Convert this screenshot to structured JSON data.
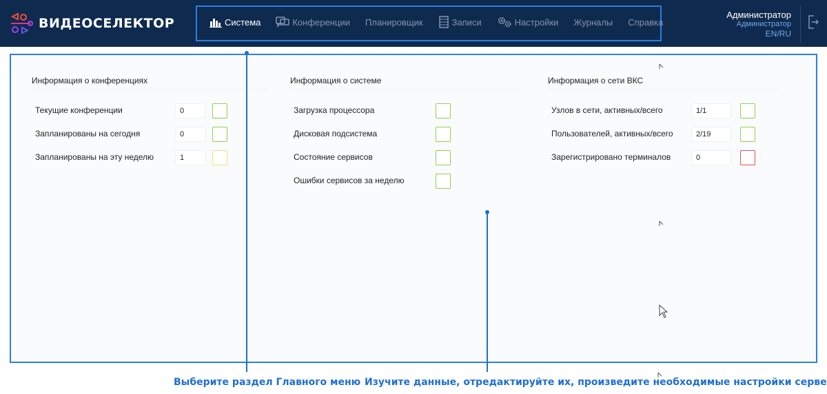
{
  "app": {
    "logo_text": "ВИДЕОСЕЛЕКТОР"
  },
  "nav": {
    "items": [
      {
        "label": "Система",
        "icon": "bar-chart-icon",
        "active": true
      },
      {
        "label": "Конференции",
        "icon": "chat-bubbles-icon",
        "active": false
      },
      {
        "label": "Планировщик",
        "icon": "",
        "active": false
      },
      {
        "label": "Записи",
        "icon": "film-icon",
        "active": false
      },
      {
        "label": "Настройки",
        "icon": "gears-icon",
        "active": false
      },
      {
        "label": "Журналы",
        "icon": "",
        "active": false
      },
      {
        "label": "Справка",
        "icon": "",
        "active": false
      }
    ]
  },
  "user": {
    "name": "Администратор",
    "role": "Администратор",
    "lang": "EN/RU"
  },
  "panels": {
    "conferences": {
      "title": "Информация о конференциях",
      "rows": [
        {
          "label": "Текущие конференции",
          "value": "0",
          "status": "green"
        },
        {
          "label": "Запланированы на сегодня",
          "value": "0",
          "status": "green"
        },
        {
          "label": "Запланированы на эту неделю",
          "value": "1",
          "status": "yellow"
        }
      ]
    },
    "system": {
      "title": "Информация о системе",
      "rows": [
        {
          "label": "Загрузка процессора",
          "status": "green"
        },
        {
          "label": "Дисковая подсистема",
          "status": "green"
        },
        {
          "label": "Состояние сервисов",
          "status": "green"
        },
        {
          "label": "Ошибки сервисов за неделю",
          "status": "green"
        }
      ]
    },
    "network": {
      "title": "Информация о сети ВКС",
      "rows": [
        {
          "label": "Узлов в сети, активных/всего",
          "value": "1/1",
          "status": "green"
        },
        {
          "label": "Пользователей, активных/всего",
          "value": "2/19",
          "status": "green"
        },
        {
          "label": "Зарегистрировано терминалов",
          "value": "0",
          "status": "red"
        }
      ]
    }
  },
  "status_colors": {
    "green": "#8fd14f",
    "yellow": "#e8e37a",
    "red": "#e05050"
  },
  "annotations": {
    "left": "Выберите раздел Главного меню",
    "right": "Изучите данные, отредактируйте их, произведите необходимые настройки сервера"
  },
  "colors": {
    "header_bg": "#0f2a4f",
    "accent": "#2d7fe0",
    "annotation": "#1f6fd1"
  }
}
